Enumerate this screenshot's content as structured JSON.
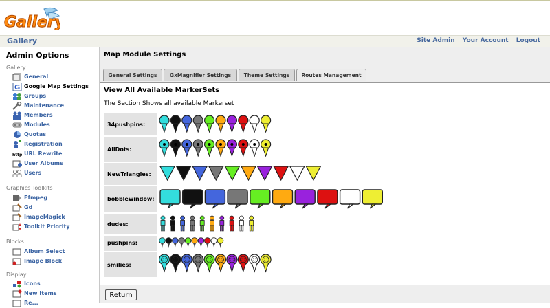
{
  "header": {
    "logo_text": "Gallery"
  },
  "topbar": {
    "breadcrumb": "Gallery",
    "links": [
      "Site Admin",
      "Your Account",
      "Logout"
    ]
  },
  "sidebar": {
    "title": "Admin Options",
    "groups": [
      {
        "label": "Gallery",
        "items": [
          "General",
          "Google Map Settings",
          "Groups",
          "Maintenance",
          "Members",
          "Modules",
          "Quotas",
          "Registration",
          "URL Rewrite",
          "User Albums",
          "Users"
        ]
      },
      {
        "label": "Graphics Toolkits",
        "items": [
          "Ffmpeg",
          "Gd",
          "ImageMagick",
          "Toolkit Priority"
        ]
      },
      {
        "label": "Blocks",
        "items": [
          "Album Select",
          "Image Block"
        ]
      },
      {
        "label": "Display",
        "items": [
          "Icons",
          "New Items",
          "Re..."
        ]
      }
    ],
    "active_item": "Google Map Settings"
  },
  "main": {
    "title": "Map Module Settings",
    "tabs": [
      "General Settings",
      "GxMagnifier Settings",
      "Theme Settings",
      "Routes Management"
    ],
    "view_title": "View All Available MarkerSets",
    "section_desc": "The Section Shows all available Markerset",
    "marker_sets": [
      {
        "name": "34pushpins:",
        "style": "pin"
      },
      {
        "name": "AllDots:",
        "style": "dot"
      },
      {
        "name": "NewTriangles:",
        "style": "triangle"
      },
      {
        "name": "bobblewindow:",
        "style": "bubble"
      },
      {
        "name": "dudes:",
        "style": "dude"
      },
      {
        "name": "pushpins:",
        "style": "smallpin"
      },
      {
        "name": "smilies:",
        "style": "smiley"
      }
    ],
    "marker_colors": [
      "#33dddd",
      "#111111",
      "#4466dd",
      "#777777",
      "#66ee22",
      "#ffaa11",
      "#9922dd",
      "#dd1111",
      "#ffffff",
      "#eeee33"
    ],
    "return_label": "Return"
  }
}
